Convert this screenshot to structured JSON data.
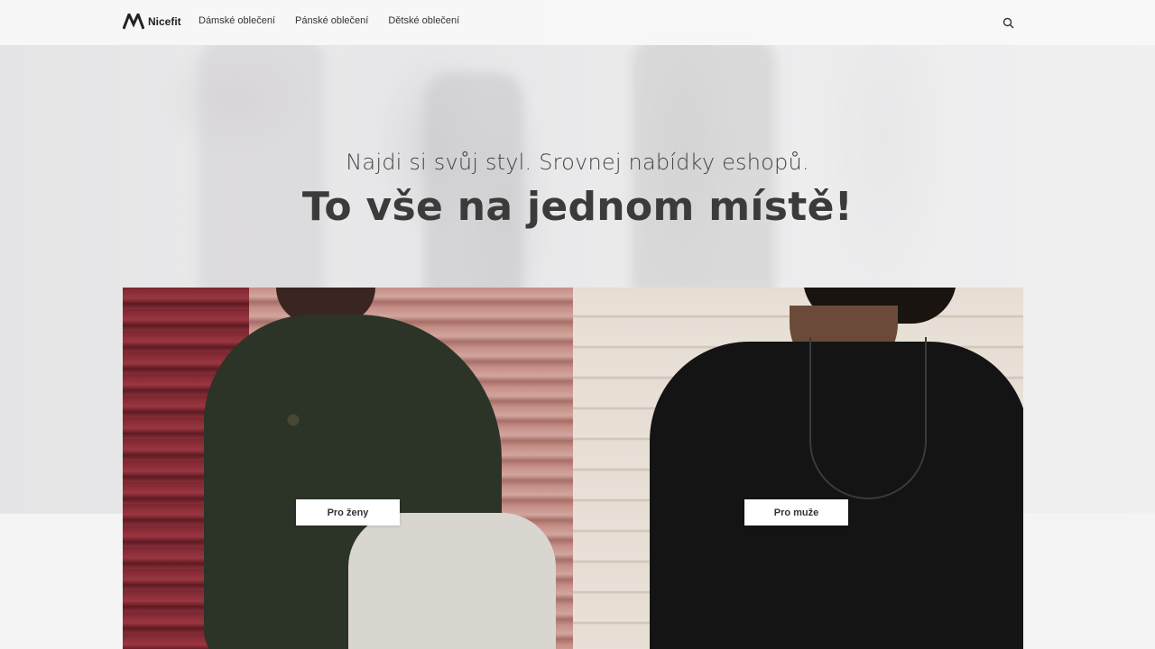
{
  "header": {
    "logo_text": "Nicefit",
    "logo_icon": "m-logo-icon",
    "nav": [
      {
        "label": "Dámské oblečení"
      },
      {
        "label": "Pánské oblečení"
      },
      {
        "label": "Dětské oblečení"
      }
    ],
    "search_icon": "search-icon"
  },
  "hero": {
    "subtitle": "Najdi si svůj styl. Srovnej nabídky eshopů.",
    "headline": "To vše na jednom místě!"
  },
  "categories": [
    {
      "button_label": "Pro ženy"
    },
    {
      "button_label": "Pro muže"
    }
  ],
  "colors": {
    "text_dark": "#3b3b3b",
    "header_bg": "#f8f8f8",
    "button_bg": "#ffffff"
  }
}
